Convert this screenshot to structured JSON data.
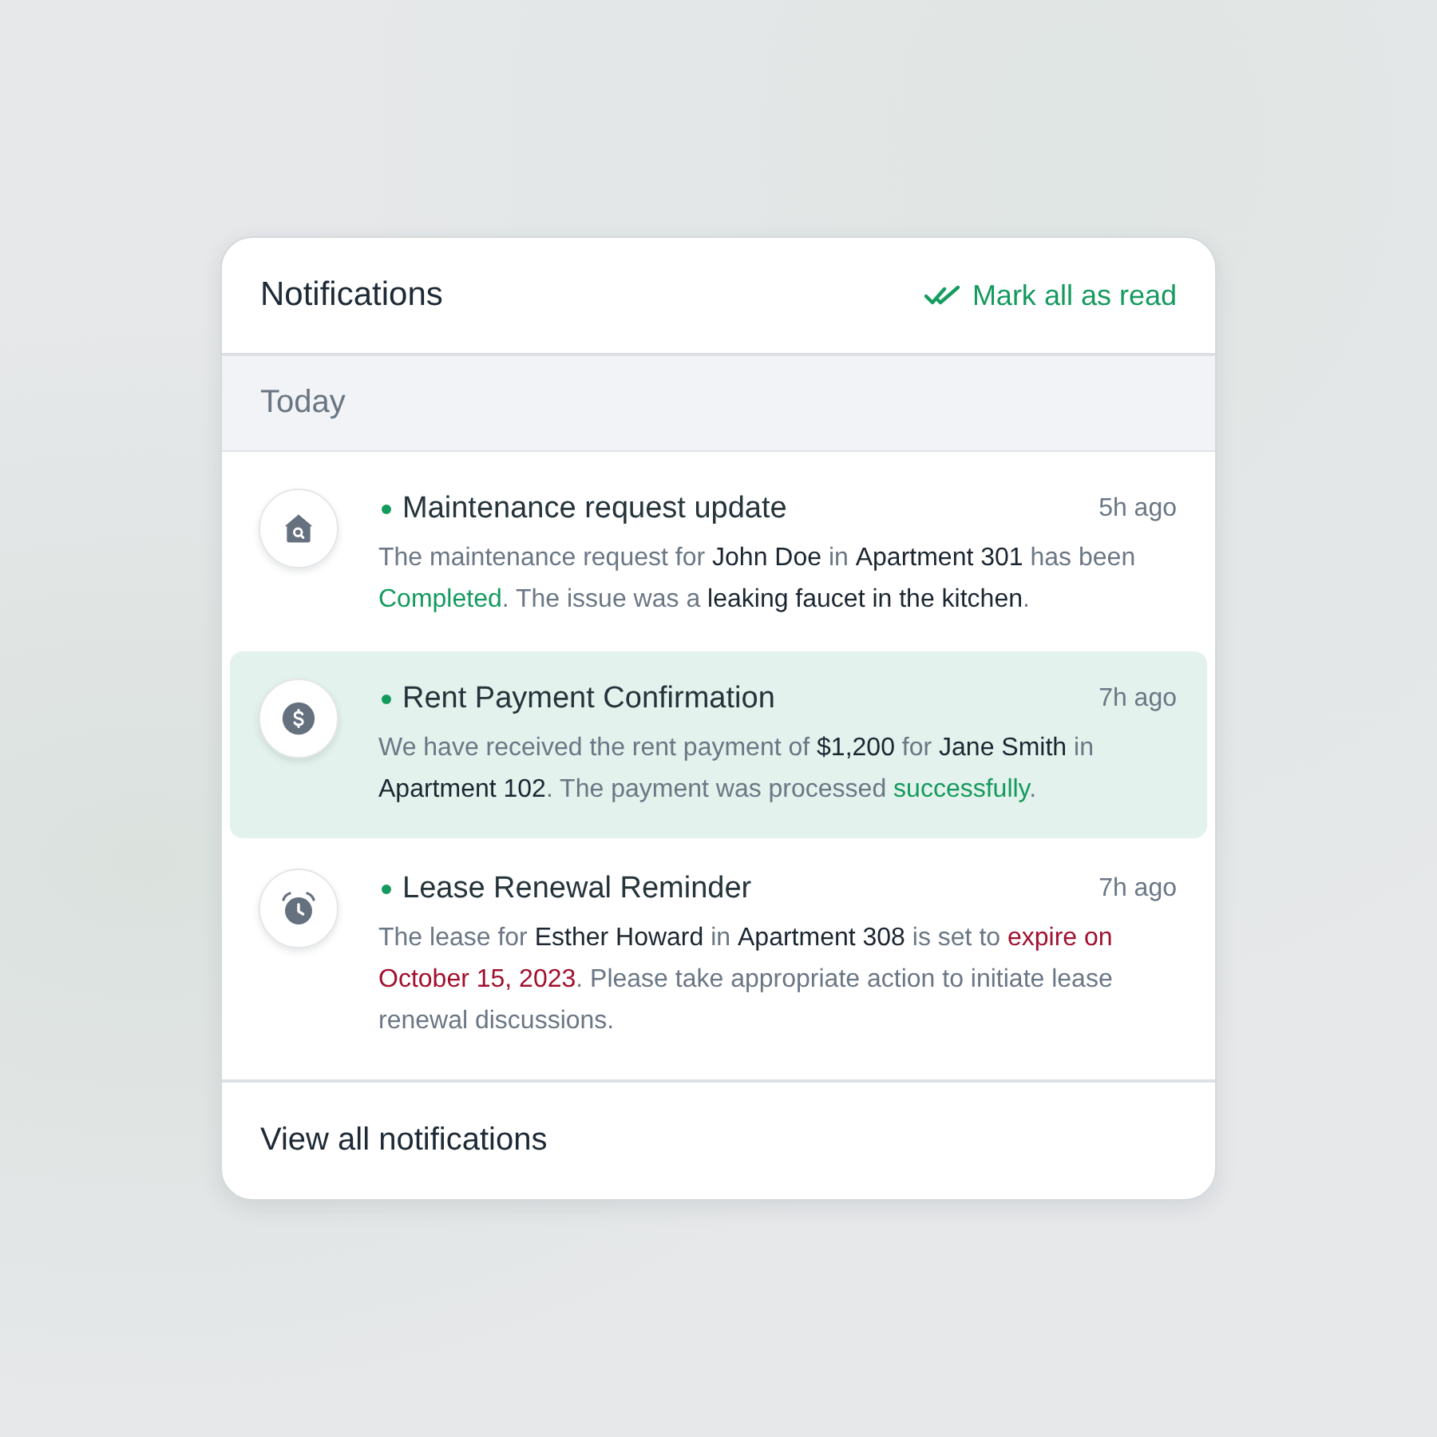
{
  "header": {
    "title": "Notifications",
    "mark_all_read": "Mark all as read"
  },
  "section": {
    "label": "Today"
  },
  "notifications": [
    {
      "kind": "maintenance",
      "title": "Maintenance request update",
      "time": "5h ago",
      "unread": true,
      "selected": false,
      "message": [
        {
          "kind": "plain",
          "text": "The maintenance request for "
        },
        {
          "kind": "strong",
          "text": "John Doe"
        },
        {
          "kind": "plain",
          "text": " in "
        },
        {
          "kind": "strong",
          "text": "Apartment 301"
        },
        {
          "kind": "plain",
          "text": " has been "
        },
        {
          "kind": "success",
          "text": "Completed"
        },
        {
          "kind": "plain",
          "text": ". The issue was a "
        },
        {
          "kind": "strong",
          "text": "leaking faucet in the kitchen"
        },
        {
          "kind": "plain",
          "text": "."
        }
      ]
    },
    {
      "kind": "payment",
      "title": "Rent Payment Confirmation",
      "time": "7h ago",
      "unread": true,
      "selected": true,
      "message": [
        {
          "kind": "plain",
          "text": "We have received the rent payment of "
        },
        {
          "kind": "strong",
          "text": "$1,200"
        },
        {
          "kind": "plain",
          "text": " for "
        },
        {
          "kind": "strong",
          "text": "Jane Smith"
        },
        {
          "kind": "plain",
          "text": " in "
        },
        {
          "kind": "strong",
          "text": "Apartment 102"
        },
        {
          "kind": "plain",
          "text": ". The payment was processed "
        },
        {
          "kind": "success",
          "text": "successfully"
        },
        {
          "kind": "plain",
          "text": "."
        }
      ]
    },
    {
      "kind": "reminder",
      "title": "Lease Renewal Reminder",
      "time": "7h ago",
      "unread": true,
      "selected": false,
      "message": [
        {
          "kind": "plain",
          "text": "The lease for "
        },
        {
          "kind": "strong",
          "text": "Esther Howard"
        },
        {
          "kind": "plain",
          "text": " in "
        },
        {
          "kind": "strong",
          "text": "Apartment 308"
        },
        {
          "kind": "plain",
          "text": " is set to "
        },
        {
          "kind": "danger",
          "text": "expire on October 15, 2023"
        },
        {
          "kind": "plain",
          "text": ". Please take appropriate action to initiate lease renewal discussions."
        }
      ]
    }
  ],
  "footer": {
    "link": "View all notifications"
  }
}
